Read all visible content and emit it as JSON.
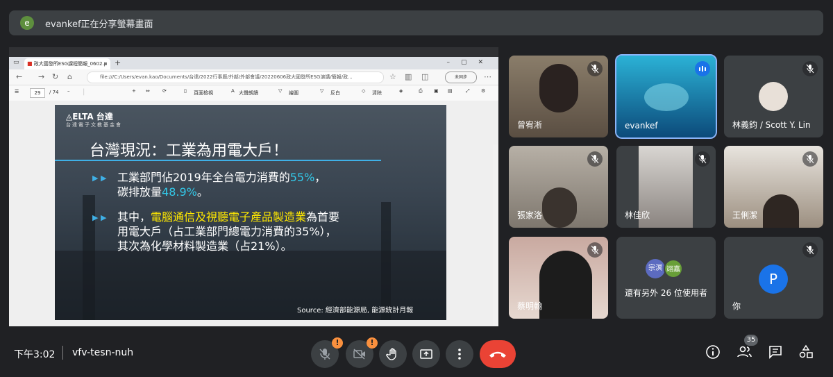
{
  "banner": {
    "avatar_letter": "e",
    "text": "evankef正在分享螢幕畫面"
  },
  "browser": {
    "tab_title": "政大國發所ESG課程簡報_0602.p",
    "url": "file:///C:/Users/evan.kao/Documents/台達/2022行事曆/外部/外部會議/20220606政大國發所ESG演講/簡報/政...",
    "profile_label": "未同步",
    "pdf_page": "29",
    "pdf_total": "/ 74",
    "pdf_view_label": "頁面檢視",
    "pdf_read_label": "大聲朗讀",
    "pdf_draw_label": "繪圖",
    "pdf_highlight_label": "反白",
    "pdf_erase_label": "清除"
  },
  "slide": {
    "logo": "◬ELTA 台達",
    "logo_sub": "台達電子文教基金會",
    "title": "台灣現況：工業為用電大戶！",
    "p1_a": "工業部門佔2019年全台電力消費的",
    "p1_hl": "55%",
    "p1_b": "，",
    "p1_c": "碳排放量",
    "p1_hl2": "48.9%",
    "p1_d": "。",
    "p2_a": "其中，",
    "p2_hl": "電腦通信及視聽電子產品製造業",
    "p2_b": "為首要",
    "p2_c": "用電大戶（占工業部門總電力消費的35%），",
    "p2_d": "其次為化學材料製造業（占21%）。",
    "source": "Source: 經濟部能源局, 能源統計月報"
  },
  "participants": [
    {
      "name": "曾宥淅",
      "muted": true
    },
    {
      "name": "evankef",
      "muted": false,
      "speaking": true
    },
    {
      "name": "林義鈞 / Scott Y. Lin",
      "muted": true
    },
    {
      "name": "張家洛",
      "muted": true
    },
    {
      "name": "林佳欣",
      "muted": true
    },
    {
      "name": "王俐潔",
      "muted": true
    },
    {
      "name": "蔡明翰",
      "muted": true
    },
    {
      "name": "還有另外 26 位使用者",
      "avatar1": "宗溟",
      "avatar2": "翊嘉"
    },
    {
      "name": "你",
      "avatar_letter": "P",
      "muted": true
    }
  ],
  "footer": {
    "time": "下午3:02",
    "meeting_code": "vfv-tesn-nuh",
    "participant_count": "35"
  },
  "colors": {
    "end_call": "#ea4335",
    "warning": "#fa903e",
    "speaking": "#8ab4f8",
    "accent_cyan": "#33c8e8",
    "accent_yellow": "#ffe800"
  }
}
